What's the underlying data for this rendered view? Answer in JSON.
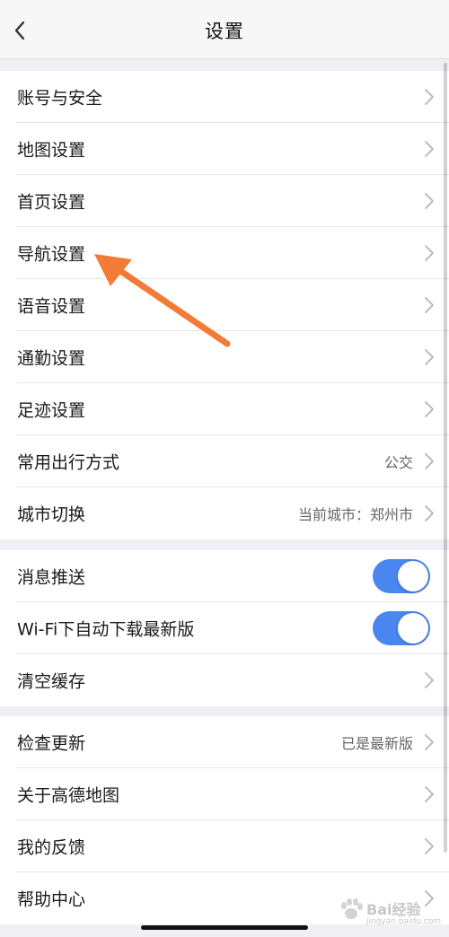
{
  "nav": {
    "title": "设置",
    "back_icon": "chevron-left-icon"
  },
  "groups": [
    {
      "items": [
        {
          "label": "账号与安全",
          "value": null,
          "control": "chevron"
        },
        {
          "label": "地图设置",
          "value": null,
          "control": "chevron"
        },
        {
          "label": "首页设置",
          "value": null,
          "control": "chevron"
        },
        {
          "label": "导航设置",
          "value": null,
          "control": "chevron"
        },
        {
          "label": "语音设置",
          "value": null,
          "control": "chevron"
        },
        {
          "label": "通勤设置",
          "value": null,
          "control": "chevron"
        },
        {
          "label": "足迹设置",
          "value": null,
          "control": "chevron"
        },
        {
          "label": "常用出行方式",
          "value": "公交",
          "control": "chevron"
        },
        {
          "label": "城市切换",
          "value": "当前城市：郑州市",
          "control": "chevron"
        }
      ]
    },
    {
      "items": [
        {
          "label": "消息推送",
          "value": null,
          "control": "toggle",
          "on": true
        },
        {
          "label": "Wi-Fi下自动下载最新版",
          "value": null,
          "control": "toggle",
          "on": true
        },
        {
          "label": "清空缓存",
          "value": null,
          "control": "chevron"
        }
      ]
    },
    {
      "items": [
        {
          "label": "检查更新",
          "value": "已是最新版",
          "control": "chevron"
        },
        {
          "label": "关于高德地图",
          "value": null,
          "control": "chevron"
        },
        {
          "label": "我的反馈",
          "value": null,
          "control": "chevron"
        },
        {
          "label": "帮助中心",
          "value": null,
          "control": "chevron"
        }
      ]
    }
  ],
  "watermark": {
    "brand": "Bai经验",
    "sub": "jingyan.baidu.com"
  },
  "colors": {
    "accent": "#4a86f0",
    "annotation_arrow": "#f27b35",
    "background": "#efeff4"
  }
}
